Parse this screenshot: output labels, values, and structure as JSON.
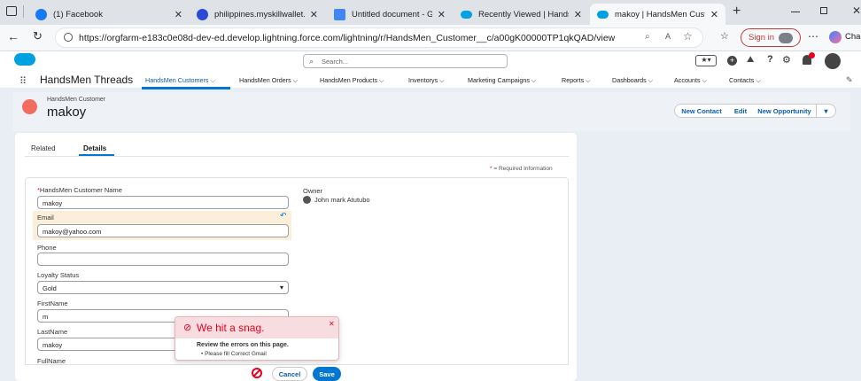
{
  "browser": {
    "tabs": [
      {
        "title": "(1) Facebook",
        "favicon": "facebook-icon",
        "color": "#1877f2"
      },
      {
        "title": "philippines.myskillwallet.ai",
        "favicon": "skillwallet-icon",
        "color": "#2a4bd7"
      },
      {
        "title": "Untitled document - Google",
        "favicon": "docs-icon",
        "color": "#4285f4"
      },
      {
        "title": "Recently Viewed | HandsMen",
        "favicon": "salesforce-cloud-icon",
        "color": "#00a1e0"
      },
      {
        "title": "makoy | HandsMen Custon",
        "favicon": "salesforce-cloud-icon",
        "color": "#00a1e0"
      }
    ],
    "url": "https://orgfarm-e183c0e08d-dev-ed.develop.lightning.force.com/lightning/r/HandsMen_Customer__c/a00gK00000TP1qkQAD/view",
    "sign_in": "Sign in",
    "copilot_label": "Cha"
  },
  "sf": {
    "search_placeholder": "Search...",
    "app_name": "HandsMen Threads",
    "nav": [
      {
        "label": "HandsMen Customers",
        "active": true
      },
      {
        "label": "HandsMen Orders"
      },
      {
        "label": "HandsMen Products"
      },
      {
        "label": "Inventorys"
      },
      {
        "label": "Marketing Campaigns"
      },
      {
        "label": "Reports"
      },
      {
        "label": "Dashboards"
      },
      {
        "label": "Accounts"
      },
      {
        "label": "Contacts"
      }
    ],
    "brand_color": "#0176d3"
  },
  "record": {
    "object_label": "HandsMen Customer",
    "name": "makoy",
    "actions": {
      "new_contact": "New Contact",
      "edit": "Edit",
      "new_opportunity": "New Opportunity"
    },
    "tabs": {
      "related": "Related",
      "details": "Details"
    },
    "required_note": "= Required Information",
    "required_marker": "*",
    "fields": {
      "customer_name_label": "HandsMen Customer Name",
      "customer_name_value": "makoy",
      "email_label": "Email",
      "email_value": "makoy@yahoo.com",
      "phone_label": "Phone",
      "phone_value": "",
      "loyalty_label": "Loyalty Status",
      "loyalty_value": "Gold",
      "firstname_label": "FirstName",
      "firstname_value": "m",
      "lastname_label": "LastName",
      "lastname_value": "makoy",
      "fullname_label": "FullName",
      "owner_label": "Owner",
      "owner_value": "John mark Atutubo"
    }
  },
  "error_toast": {
    "title": "We hit a snag.",
    "message": "Review the errors on this page.",
    "bullet": "Please fill Correct Gmail",
    "color": "#ea001e"
  },
  "footer": {
    "cancel": "Cancel",
    "save": "Save"
  }
}
